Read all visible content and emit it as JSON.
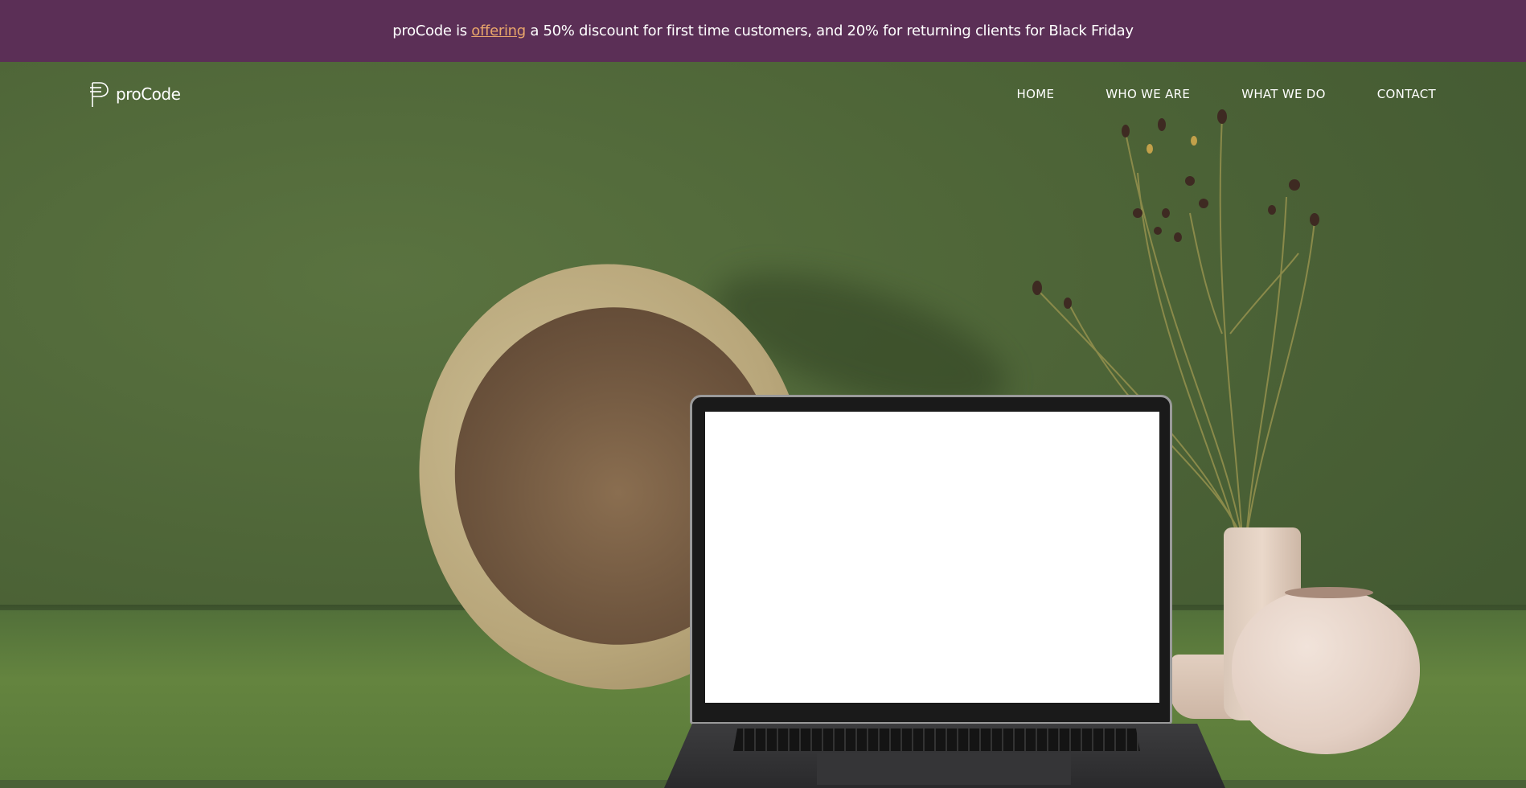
{
  "banner": {
    "prefix": "proCode is ",
    "link": "offering",
    "suffix": " a 50% discount for first time customers, and 20% for returning clients for Black Friday"
  },
  "brand": {
    "name": "proCode"
  },
  "nav": {
    "items": [
      {
        "label": "HOME"
      },
      {
        "label": "WHO WE ARE"
      },
      {
        "label": "WHAT WE DO"
      },
      {
        "label": "CONTACT"
      }
    ]
  },
  "colors": {
    "banner_bg": "#5b2f56",
    "link_accent": "#e9a66b",
    "hero_green": "#4d6437"
  }
}
